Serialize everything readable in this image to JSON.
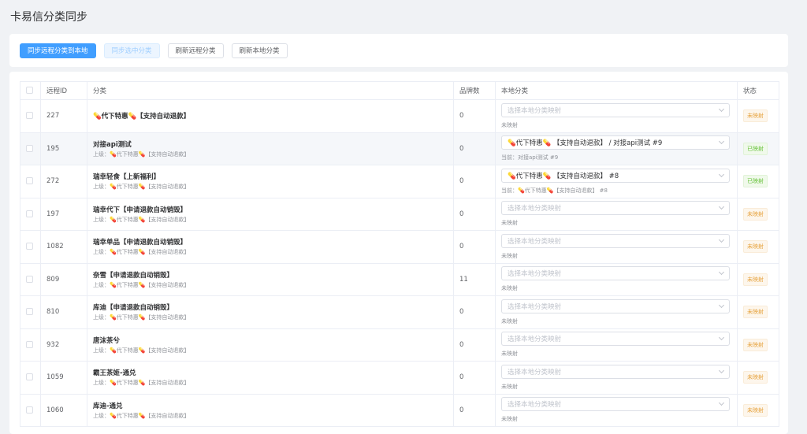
{
  "page": {
    "title": "卡易信分类同步"
  },
  "toolbar": {
    "sync_remote_to_local": "同步远程分类到本地",
    "sync_selected": "同步选中分类",
    "refresh_remote": "刷新远程分类",
    "refresh_local": "刷新本地分类"
  },
  "table": {
    "headers": {
      "remote_id": "远程ID",
      "category": "分类",
      "brand_count": "品牌数",
      "local_category": "本地分类",
      "status": "状态"
    },
    "rows": [
      {
        "id": "227",
        "name": "💊代下特惠💊【支持自动退款】",
        "parent": "",
        "brands": "0",
        "select": "选择本地分类映射",
        "mapped": false,
        "sub": "未映射",
        "status": "未映射"
      },
      {
        "id": "195",
        "name": "对接api测试",
        "parent": "上级：💊代下特惠💊【支持自动退款】",
        "brands": "0",
        "select": "💊代下特惠💊 【支持自动退款】 / 对接api测试 #9",
        "mapped": true,
        "sub": "当前：对接api测试 #9",
        "status": "已映射"
      },
      {
        "id": "272",
        "name": "瑞幸轻食【上新福利】",
        "parent": "上级：💊代下特惠💊【支持自动退款】",
        "brands": "0",
        "select": "💊代下特惠💊 【支持自动退款】 #8",
        "mapped": true,
        "sub": "当前：💊代下特惠💊【支持自动退款】 #8",
        "status": "已映射"
      },
      {
        "id": "197",
        "name": "瑞幸代下【申请退款自动销毁】",
        "parent": "上级：💊代下特惠💊【支持自动退款】",
        "brands": "0",
        "select": "选择本地分类映射",
        "mapped": false,
        "sub": "未映射",
        "status": "未映射"
      },
      {
        "id": "1082",
        "name": "瑞幸单品【申请退款自动销毁】",
        "parent": "上级：💊代下特惠💊【支持自动退款】",
        "brands": "0",
        "select": "选择本地分类映射",
        "mapped": false,
        "sub": "未映射",
        "status": "未映射"
      },
      {
        "id": "809",
        "name": "奈雪【申请退款自动销毁】",
        "parent": "上级：💊代下特惠💊【支持自动退款】",
        "brands": "11",
        "select": "选择本地分类映射",
        "mapped": false,
        "sub": "未映射",
        "status": "未映射"
      },
      {
        "id": "810",
        "name": "库迪【申请退款自动销毁】",
        "parent": "上级：💊代下特惠💊【支持自动退款】",
        "brands": "0",
        "select": "选择本地分类映射",
        "mapped": false,
        "sub": "未映射",
        "status": "未映射"
      },
      {
        "id": "932",
        "name": "唐沫茶兮",
        "parent": "上级：💊代下特惠💊【支持自动退款】",
        "brands": "0",
        "select": "选择本地分类映射",
        "mapped": false,
        "sub": "未映射",
        "status": "未映射"
      },
      {
        "id": "1059",
        "name": "霸王茶姬-通兑",
        "parent": "上级：💊代下特惠💊【支持自动退款】",
        "brands": "0",
        "select": "选择本地分类映射",
        "mapped": false,
        "sub": "未映射",
        "status": "未映射"
      },
      {
        "id": "1060",
        "name": "库迪-通兑",
        "parent": "上级：💊代下特惠💊【支持自动退款】",
        "brands": "0",
        "select": "选择本地分类映射",
        "mapped": false,
        "sub": "未映射",
        "status": "未映射"
      }
    ]
  },
  "colors": {
    "primary": "#409eff",
    "mapped": "#67c23a",
    "unmapped": "#e6a23c"
  }
}
